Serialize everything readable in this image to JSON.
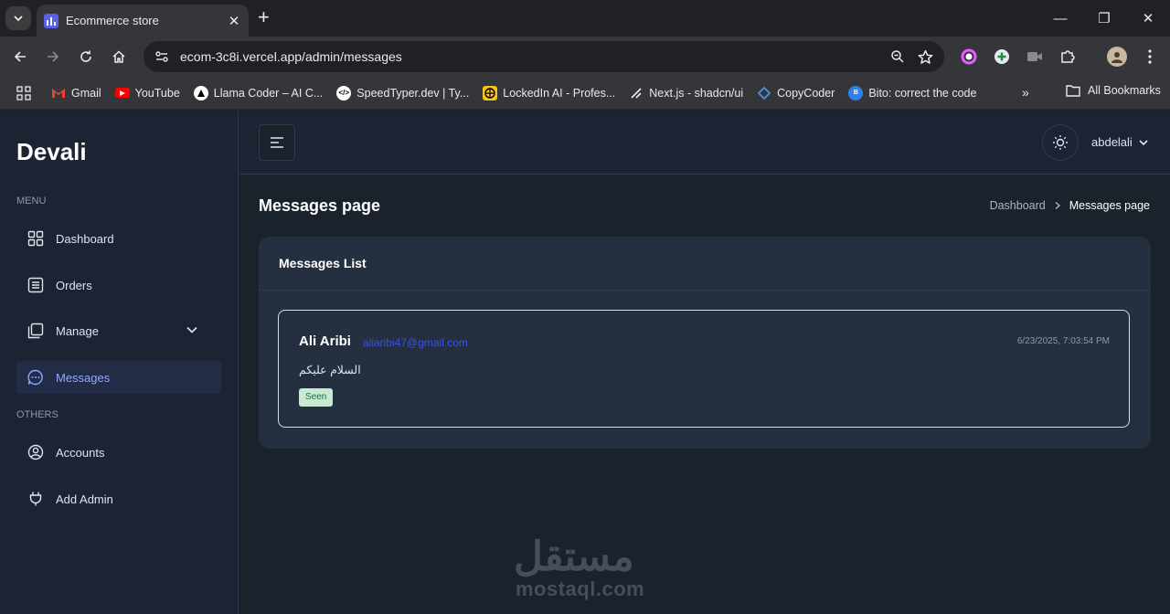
{
  "browser": {
    "tab_title": "Ecommerce store",
    "url": "ecom-3c8i.vercel.app/admin/messages",
    "bookmarks": [
      {
        "label": "Gmail",
        "icon": "gmail-icon",
        "color": "#ea4335"
      },
      {
        "label": "YouTube",
        "icon": "youtube-icon",
        "color": "#ff0000"
      },
      {
        "label": "Llama Coder – AI C...",
        "icon": "llama-icon",
        "color": "#000000"
      },
      {
        "label": "SpeedTyper.dev | Ty...",
        "icon": "code-icon",
        "color": "#000000"
      },
      {
        "label": "LockedIn AI - Profes...",
        "icon": "lockedin-icon",
        "color": "#f5c518"
      },
      {
        "label": "Next.js - shadcn/ui",
        "icon": "shadcn-icon",
        "color": "#000000"
      },
      {
        "label": "CopyCoder",
        "icon": "copycoder-icon",
        "color": "#4a90e2"
      },
      {
        "label": "Bito: correct the code",
        "icon": "bito-icon",
        "color": "#2f80ed"
      }
    ],
    "all_bookmarks": "All Bookmarks"
  },
  "sidebar": {
    "logo": "Devali",
    "menu_label": "MENU",
    "menu_items": [
      {
        "label": "Dashboard",
        "icon": "grid-icon"
      },
      {
        "label": "Orders",
        "icon": "orders-icon"
      },
      {
        "label": "Manage",
        "icon": "manage-icon"
      },
      {
        "label": "Messages",
        "icon": "chat-icon"
      }
    ],
    "others_label": "OTHERS",
    "other_items": [
      {
        "label": "Accounts",
        "icon": "user-icon"
      },
      {
        "label": "Add Admin",
        "icon": "plug-icon"
      }
    ]
  },
  "header": {
    "username": "abdelali"
  },
  "main": {
    "title": "Messages page",
    "breadcrumb": {
      "home": "Dashboard",
      "current": "Messages page"
    },
    "card_title": "Messages List",
    "messages": [
      {
        "name": "Ali Aribi",
        "email": "aliaribi47@gmail.com",
        "date": "6/23/2025, 7:03:54 PM",
        "body": "السلام عليكم",
        "status": "Seen"
      }
    ]
  },
  "watermark": {
    "arabic": "مستقل",
    "latin": "mostaql.com"
  },
  "colors": {
    "accent": "#3c50e0",
    "active_bg": "#222c47",
    "seen_bg": "#c9ead2"
  }
}
